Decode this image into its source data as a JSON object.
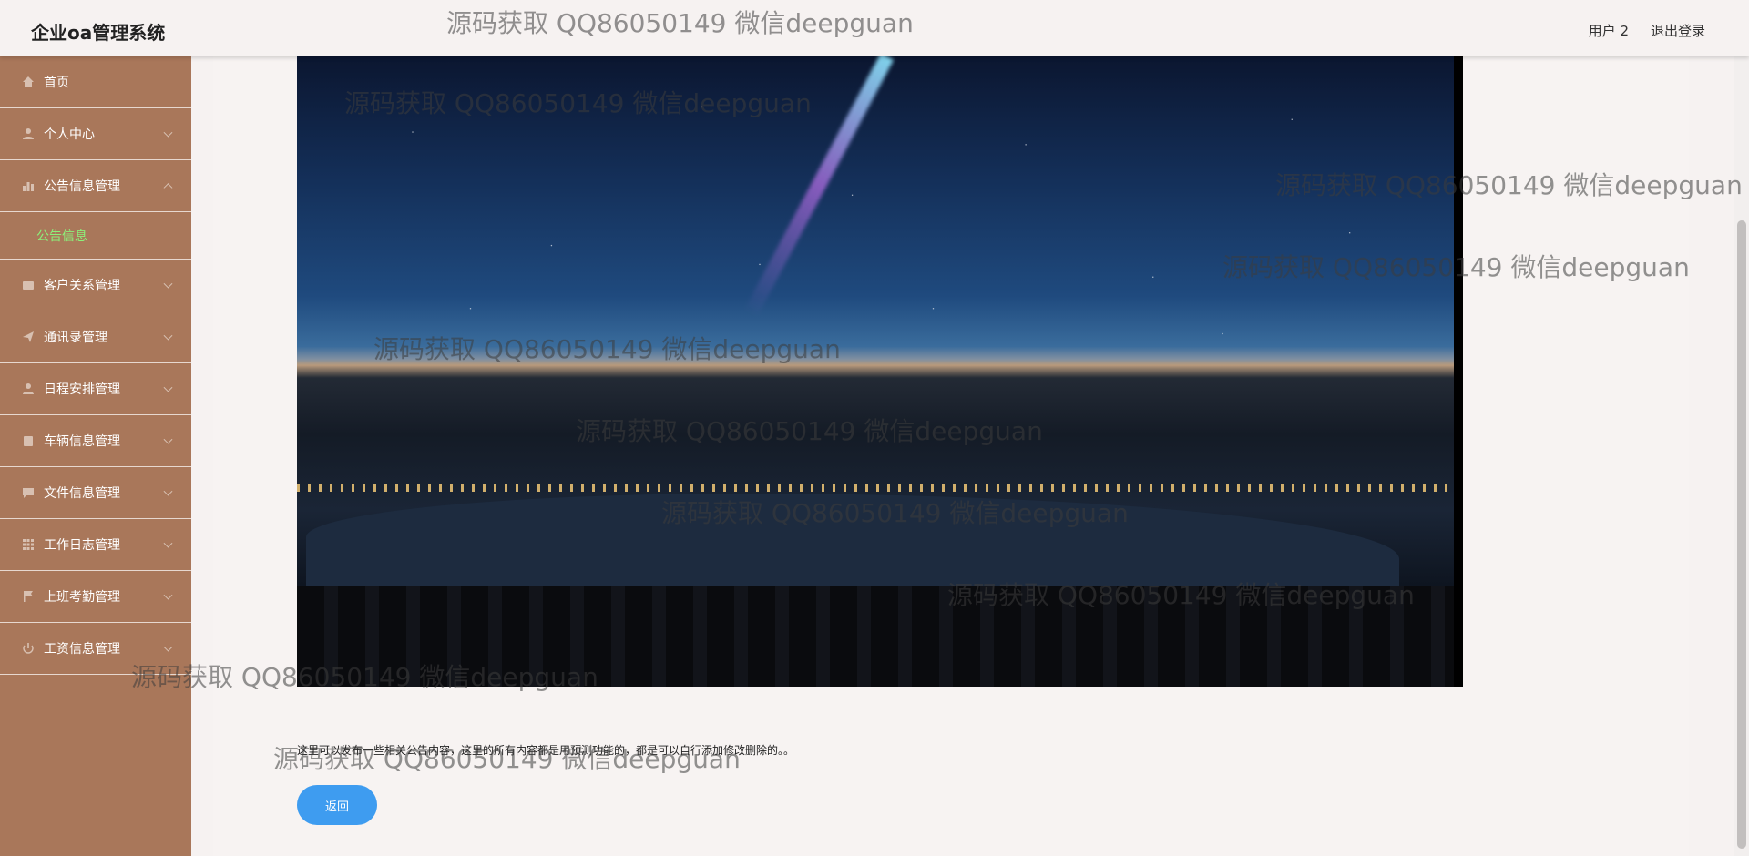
{
  "header": {
    "title": "企业oa管理系统",
    "user_label": "用户 2",
    "logout_label": "退出登录"
  },
  "sidebar": {
    "items": [
      {
        "label": "首页",
        "icon": "home-icon"
      },
      {
        "label": "个人中心",
        "icon": "user-icon"
      },
      {
        "label": "公告信息管理",
        "icon": "bar-chart-icon",
        "expanded": true
      },
      {
        "label": "客户关系管理",
        "icon": "folder-icon"
      },
      {
        "label": "通讯录管理",
        "icon": "send-icon"
      },
      {
        "label": "日程安排管理",
        "icon": "user-icon"
      },
      {
        "label": "车辆信息管理",
        "icon": "clipboard-icon"
      },
      {
        "label": "文件信息管理",
        "icon": "chat-icon"
      },
      {
        "label": "工作日志管理",
        "icon": "grid-icon"
      },
      {
        "label": "上班考勤管理",
        "icon": "flag-icon"
      },
      {
        "label": "工资信息管理",
        "icon": "power-icon"
      }
    ],
    "sub_item": "公告信息"
  },
  "main": {
    "description": "这里可以发布一些相关公告内容，这里的所有内容都是用预测功能的，都是可以自行添加修改删除的。。",
    "back_label": "返回"
  },
  "watermark": {
    "text": "源码获取 QQ86050149 微信deepguan"
  },
  "colors": {
    "sidebar_bg": "#a9775a",
    "active_sub": "#8cf07a",
    "button": "#3e9cf0"
  }
}
